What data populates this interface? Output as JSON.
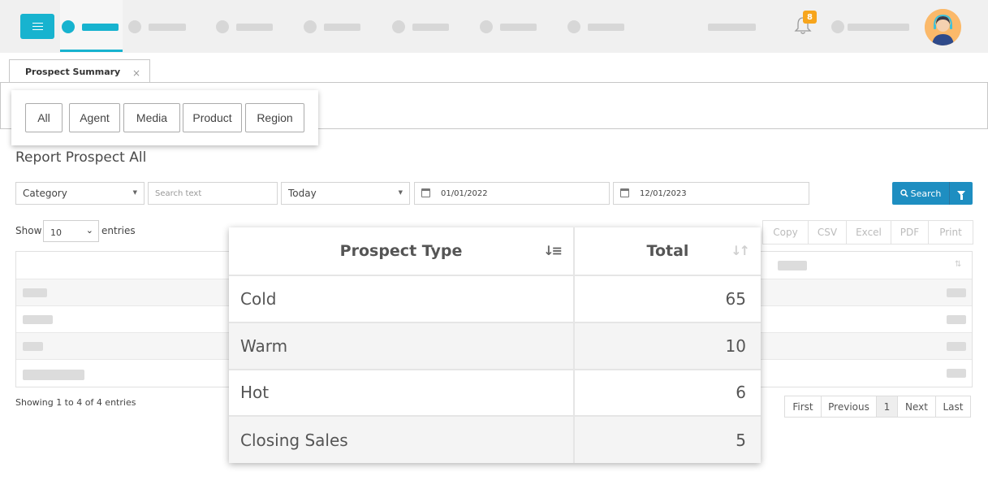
{
  "header": {
    "notification_count": "8",
    "nav_items": [
      "home",
      "item-2",
      "item-3",
      "item-4",
      "item-5",
      "item-6",
      "item-7"
    ],
    "accent_color": "#17b3cf"
  },
  "tabs": {
    "active_tab_label": "Prospect Summary",
    "close_symbol": "×"
  },
  "filters": {
    "buttons": [
      "All",
      "Agent",
      "Media",
      "Product",
      "Region"
    ]
  },
  "report": {
    "title": "Report Prospect All"
  },
  "controls": {
    "category_select": "Category",
    "search_placeholder": "Search text",
    "period_select": "Today",
    "date_from": "01/01/2022",
    "date_to": "12/01/2023",
    "search_button": "Search",
    "search_color": "#1e8ec1"
  },
  "table_controls": {
    "show_label": "Show",
    "entries_value": "10",
    "entries_label": "entries",
    "export_buttons": [
      "Copy",
      "CSV",
      "Excel",
      "PDF",
      "Print"
    ]
  },
  "footer": {
    "info": "Showing 1 to 4 of 4 entries",
    "pager": [
      "First",
      "Previous",
      "1",
      "Next",
      "Last"
    ]
  },
  "summary_table": {
    "columns": [
      "Prospect Type",
      "Total"
    ],
    "rows": [
      {
        "type": "Cold",
        "total": "65"
      },
      {
        "type": "Warm",
        "total": "10"
      },
      {
        "type": "Hot",
        "total": "6"
      },
      {
        "type": "Closing Sales",
        "total": "5"
      }
    ]
  }
}
